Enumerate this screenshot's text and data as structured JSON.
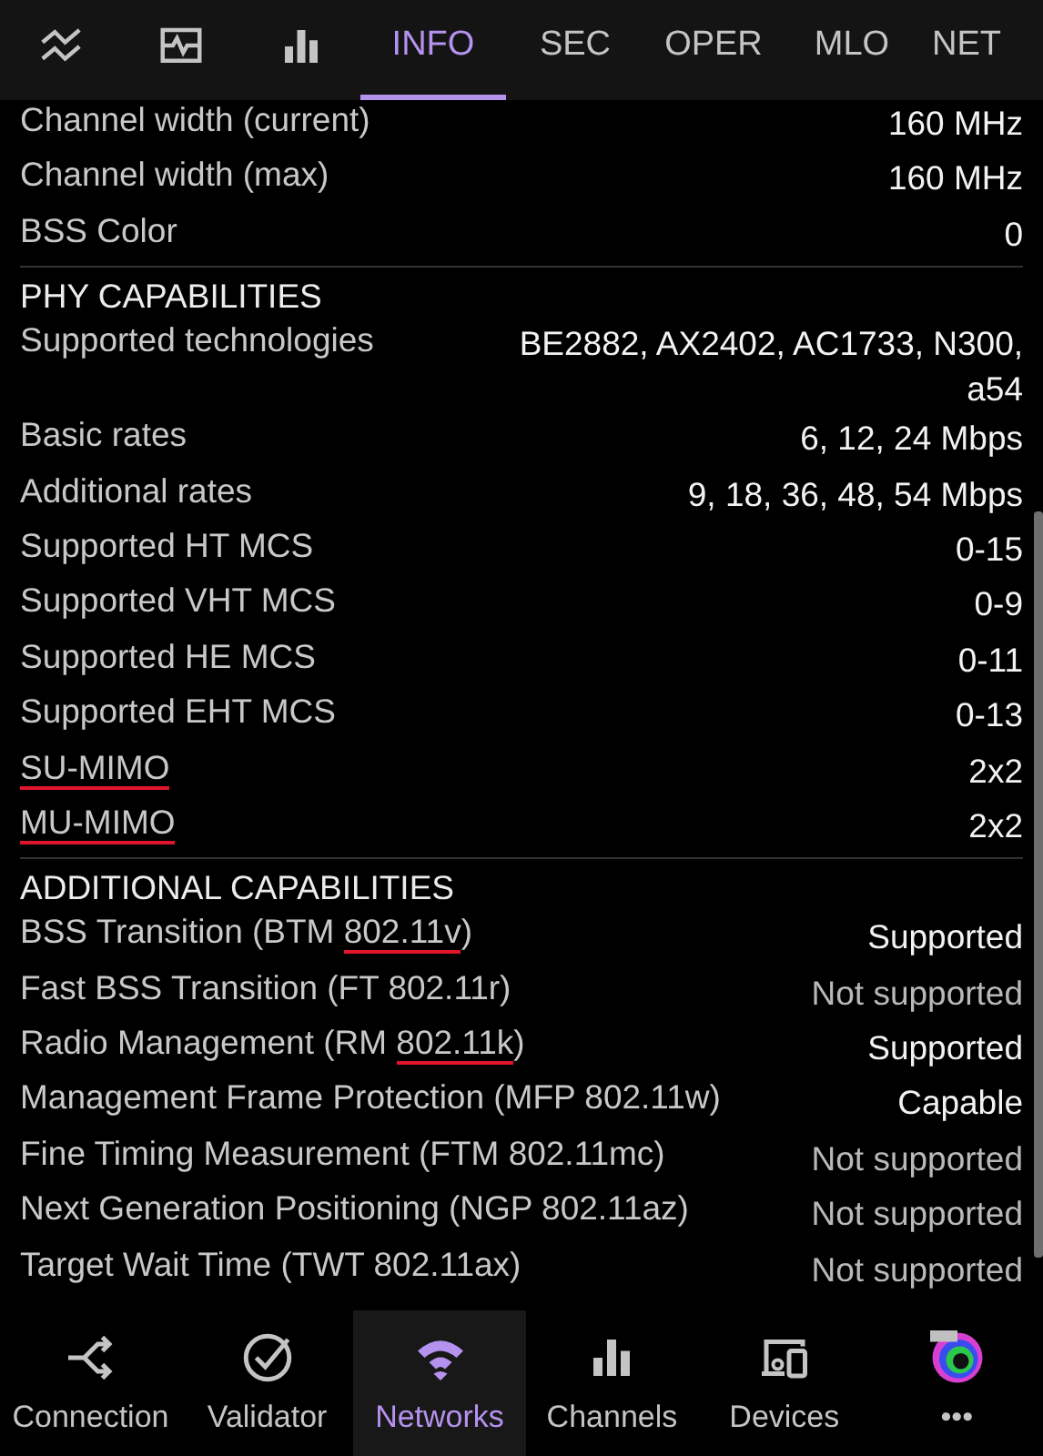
{
  "top_tabs": [
    {
      "kind": "icon",
      "selected": false
    },
    {
      "kind": "icon",
      "selected": false
    },
    {
      "kind": "icon",
      "selected": false
    },
    {
      "kind": "text",
      "label": "INFO",
      "selected": true
    },
    {
      "kind": "text",
      "label": "SEC",
      "selected": false
    },
    {
      "kind": "text",
      "label": "OPER",
      "selected": false
    },
    {
      "kind": "text",
      "label": "MLO",
      "selected": false
    },
    {
      "kind": "text",
      "label": "NET",
      "selected": false
    }
  ],
  "sections": [
    {
      "rows": [
        {
          "label": [
            {
              "text": "Channel width (current)",
              "marked": false
            }
          ],
          "value": "160 MHz",
          "dim": false
        },
        {
          "label": [
            {
              "text": "Channel width (max)",
              "marked": false
            }
          ],
          "value": "160 MHz",
          "dim": false
        },
        {
          "label": [
            {
              "text": "BSS Color",
              "marked": false
            }
          ],
          "value": "0",
          "dim": false
        }
      ]
    },
    {
      "heading": "PHY CAPABILITIES",
      "rows": [
        {
          "label": [
            {
              "text": "Supported technologies",
              "marked": false
            }
          ],
          "value": "BE2882, AX2402, AC1733, N300, a54",
          "dim": false
        },
        {
          "label": [
            {
              "text": "Basic rates",
              "marked": false
            }
          ],
          "value": "6, 12, 24 Mbps",
          "dim": false
        },
        {
          "label": [
            {
              "text": "Additional rates",
              "marked": false
            }
          ],
          "value": "9, 18, 36, 48, 54 Mbps",
          "dim": false
        },
        {
          "label": [
            {
              "text": "Supported HT MCS",
              "marked": false
            }
          ],
          "value": "0-15",
          "dim": false
        },
        {
          "label": [
            {
              "text": "Supported VHT MCS",
              "marked": false
            }
          ],
          "value": "0-9",
          "dim": false
        },
        {
          "label": [
            {
              "text": "Supported HE MCS",
              "marked": false
            }
          ],
          "value": "0-11",
          "dim": false
        },
        {
          "label": [
            {
              "text": "Supported EHT MCS",
              "marked": false
            }
          ],
          "value": "0-13",
          "dim": false
        },
        {
          "label": [
            {
              "text": "SU-MIMO",
              "marked": true
            }
          ],
          "value": "2x2",
          "dim": false
        },
        {
          "label": [
            {
              "text": "MU-MIMO",
              "marked": true
            }
          ],
          "value": "2x2",
          "dim": false
        }
      ]
    },
    {
      "heading": "ADDITIONAL CAPABILITIES",
      "rows": [
        {
          "label": [
            {
              "text": "BSS Transition (BTM ",
              "marked": false
            },
            {
              "text": "802.11v",
              "marked": true
            },
            {
              "text": ")",
              "marked": false
            }
          ],
          "value": "Supported",
          "dim": false
        },
        {
          "label": [
            {
              "text": "Fast BSS Transition (FT 802.11r)",
              "marked": false
            }
          ],
          "value": "Not supported",
          "dim": true
        },
        {
          "label": [
            {
              "text": "Radio Management (RM ",
              "marked": false
            },
            {
              "text": "802.11k",
              "marked": true
            },
            {
              "text": ")",
              "marked": false
            }
          ],
          "value": "Supported",
          "dim": false
        },
        {
          "label": [
            {
              "text": "Management Frame Protection (MFP 802.11w)",
              "marked": false
            }
          ],
          "value": "Capable",
          "dim": false
        },
        {
          "label": [
            {
              "text": "Fine Timing Measurement (FTM 802.11mc)",
              "marked": false
            }
          ],
          "value": "Not supported",
          "dim": true
        },
        {
          "label": [
            {
              "text": "Next Generation Positioning (NGP 802.11az)",
              "marked": false
            }
          ],
          "value": "Not supported",
          "dim": true
        },
        {
          "label": [
            {
              "text": "Target Wait Time (TWT 802.11ax)",
              "marked": false
            }
          ],
          "value": "Not supported",
          "dim": true
        }
      ]
    }
  ],
  "bottom_nav": [
    {
      "label": "Connection",
      "selected": false
    },
    {
      "label": "Validator",
      "selected": false
    },
    {
      "label": "Networks",
      "selected": true
    },
    {
      "label": "Channels",
      "selected": false
    },
    {
      "label": "Devices",
      "selected": false
    },
    {
      "label": "•••",
      "selected": false
    }
  ]
}
